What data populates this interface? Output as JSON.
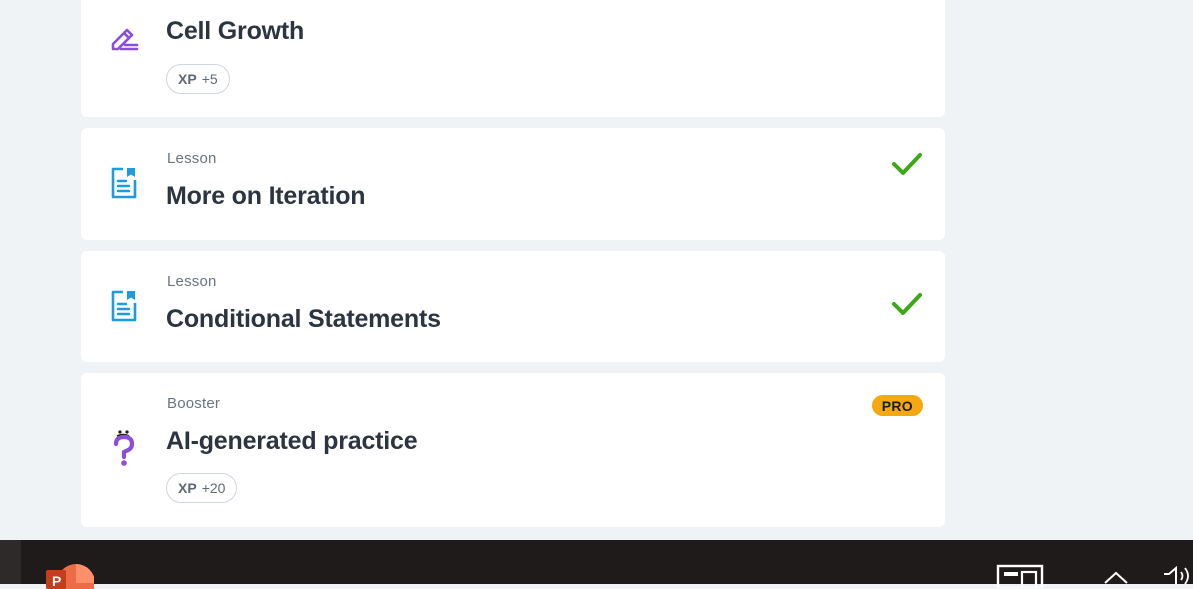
{
  "cards": [
    {
      "type": "",
      "title": "Cell Growth",
      "icon": "pencil-edit-icon",
      "xp_label": "XP",
      "xp_value": "+5"
    },
    {
      "type": "Lesson",
      "title": "More on Iteration",
      "icon": "lesson-document-icon",
      "completed": true
    },
    {
      "type": "Lesson",
      "title": "Conditional Statements",
      "icon": "lesson-document-icon",
      "completed": true
    },
    {
      "type": "Booster",
      "title": "AI-generated practice",
      "icon": "question-mark-icon",
      "badge": "PRO",
      "xp_label": "XP",
      "xp_value": "+20"
    }
  ],
  "colors": {
    "background": "#f0f3f6",
    "card": "#ffffff",
    "title": "#2b3440",
    "subtle": "#6a7581",
    "pencil": "#8a4fd6",
    "lesson_blue": "#1e9be0",
    "check_green": "#3aaa14",
    "pro_orange": "#f5a80f",
    "taskbar": "#1f1b1a"
  },
  "taskbar": {
    "apps": [
      "powerpoint-icon"
    ],
    "tray": [
      "news-widget-icon",
      "chevron-up-icon",
      "speaker-icon"
    ]
  }
}
